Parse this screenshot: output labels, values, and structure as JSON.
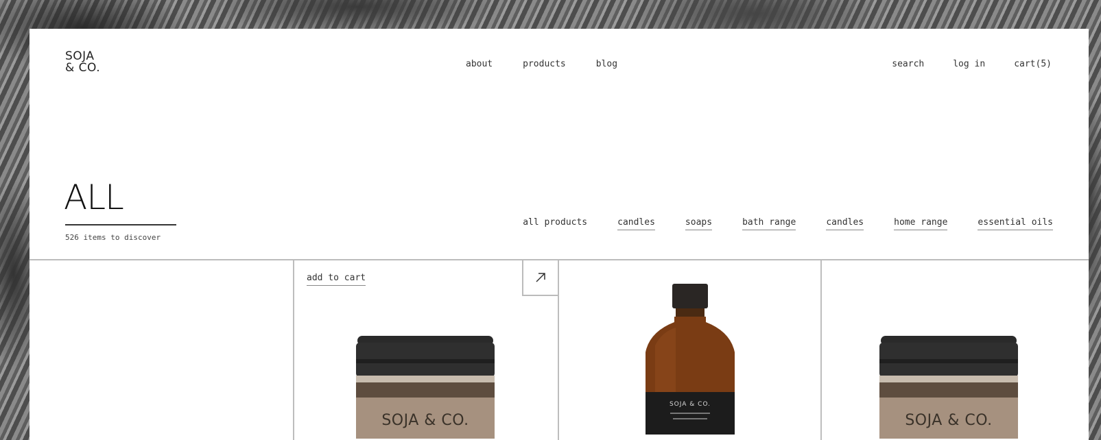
{
  "brand": {
    "line1": "SOJA",
    "line2": "& CO."
  },
  "nav": {
    "about": "about",
    "products": "products",
    "blog": "blog"
  },
  "utility": {
    "search": "search",
    "login": "log in",
    "cart": "cart(5)"
  },
  "page": {
    "heading": "ALL",
    "item_count": "526 items to discover"
  },
  "filters": [
    {
      "label": "all products",
      "active": true
    },
    {
      "label": "candles",
      "active": false
    },
    {
      "label": "soaps",
      "active": false
    },
    {
      "label": "bath range",
      "active": false
    },
    {
      "label": "candles",
      "active": false
    },
    {
      "label": "home range",
      "active": false
    },
    {
      "label": "essential oils",
      "active": false
    }
  ],
  "products": [
    {
      "add_to_cart": "add to cart",
      "label": "SOJA & CO.",
      "type": "jar"
    },
    {
      "label": "SOJA & CO.",
      "type": "bottle"
    },
    {
      "label": "SOJA & CO.",
      "type": "jar"
    }
  ],
  "icons": {
    "expand": "arrow-up-right-icon"
  }
}
